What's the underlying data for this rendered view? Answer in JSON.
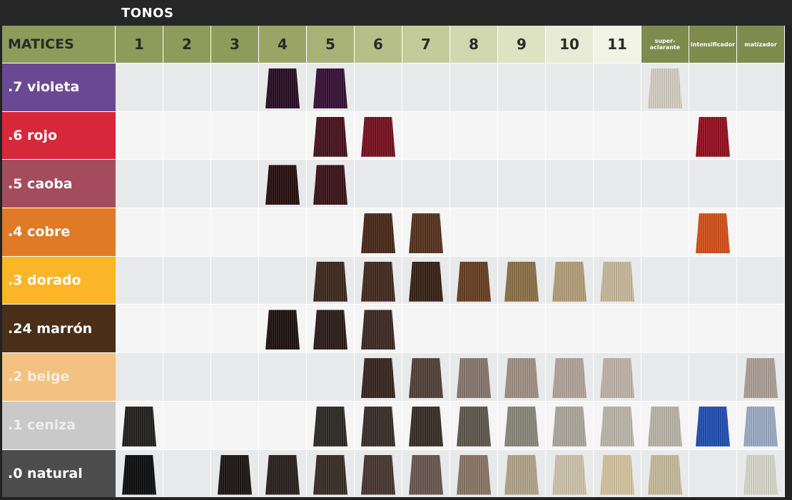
{
  "title": "TONOS",
  "header": {
    "matices_label": "MATICES",
    "columns": [
      "1",
      "2",
      "3",
      "4",
      "5",
      "6",
      "7",
      "8",
      "9",
      "10",
      "11",
      "super-aclarante",
      "intensificador",
      "matizador"
    ],
    "column_colors": [
      "#8f9b5a",
      "#8f9b5a",
      "#8f9b5a",
      "#9aa565",
      "#a8b276",
      "#b6bf88",
      "#c4cb9b",
      "#d1d7ae",
      "#dde2c2",
      "#e8ebd5",
      "#f1f3e4",
      "#7f8a4d",
      "#7f8a4d",
      "#7f8a4d"
    ]
  },
  "rows": [
    {
      "label": ".7 violeta",
      "color": "#6b4894",
      "text_color": "#ffffff",
      "swatches": {
        "4": "#2a1027",
        "5": "#3a1238",
        "super-aclarante": "#d9d4c8"
      }
    },
    {
      "label": ".6 rojo",
      "color": "#d7283b",
      "text_color": "#ffffff",
      "swatches": {
        "5": "#4a1420",
        "6": "#7a1220",
        "intensificador": "#9a1020"
      }
    },
    {
      "label": ".5 caoba",
      "color": "#a54b5e",
      "text_color": "#ffffff",
      "swatches": {
        "4": "#2a1211",
        "5": "#3d1418"
      }
    },
    {
      "label": ".4 cobre",
      "color": "#e07a27",
      "text_color": "#ffffff",
      "swatches": {
        "6": "#4b2b18",
        "7": "#5a3420",
        "intensificador": "#d9531b"
      }
    },
    {
      "label": ".3 dorado",
      "color": "#fbb627",
      "text_color": "#ffffff",
      "swatches": {
        "5": "#3f2a1f",
        "6": "#452c21",
        "7": "#3a2416",
        "8": "#6a4226",
        "9": "#8f744a",
        "10": "#b8a27c",
        "11": "#cdbd9e"
      }
    },
    {
      "label": ".24 marrón",
      "color": "#4a2e18",
      "text_color": "#ffffff",
      "swatches": {
        "4": "#1f1513",
        "5": "#2e1f1b",
        "6": "#3f2b26"
      }
    },
    {
      "label": ".2 beige",
      "color": "#f3c180",
      "text_color": "#f7eee0",
      "swatches": {
        "6": "#3a2721",
        "7": "#55443a",
        "8": "#8a7b6f",
        "9": "#a49488",
        "10": "#b5a89e",
        "11": "#c4b8ad",
        "matizador": "#b0a49b"
      }
    },
    {
      "label": ".1 ceniza",
      "color": "#c9c9c9",
      "text_color": "#eeeeee",
      "swatches": {
        "1": "#24231f",
        "5": "#302d28",
        "6": "#3b302b",
        "7": "#3a3128",
        "8": "#615a50",
        "9": "#8d8a7d",
        "10": "#b0ab9f",
        "11": "#c0bbae",
        "super-aclarante": "#bdb9ab",
        "intensificador": "#2351b4",
        "matizador": "#9fb0c8"
      }
    },
    {
      "label": ".0 natural",
      "color": "#4c4c4c",
      "text_color": "#ffffff",
      "swatches": {
        "1": "#0f0f0f",
        "3": "#1e1816",
        "4": "#2b221e",
        "5": "#3b2e28",
        "6": "#4a3933",
        "7": "#6d5a52",
        "8": "#8c7868",
        "9": "#b7a88f",
        "10": "#d2c8b0",
        "11": "#d9c9a5",
        "super-aclarante": "#cbbf9f",
        "matizador": "#dcdcd0"
      }
    }
  ]
}
